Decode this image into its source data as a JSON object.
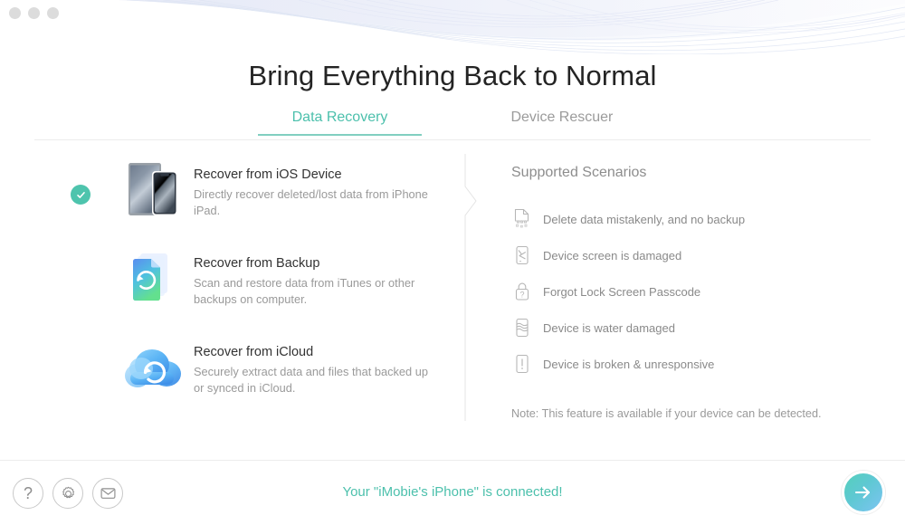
{
  "window": {
    "dots": [
      "close-dot",
      "minimize-dot",
      "maximize-dot"
    ]
  },
  "header": {
    "title": "Bring Everything Back to Normal"
  },
  "tabs": [
    {
      "label": "Data Recovery",
      "active": true
    },
    {
      "label": "Device Rescuer",
      "active": false
    }
  ],
  "options": [
    {
      "title": "Recover from iOS Device",
      "desc": "Directly recover deleted/lost data from iPhone iPad.",
      "icon": "ipad-iphone-devices-icon",
      "selected": true
    },
    {
      "title": "Recover from Backup",
      "desc": "Scan and restore data from iTunes or other backups on computer.",
      "icon": "backup-folder-refresh-icon",
      "selected": false
    },
    {
      "title": "Recover from iCloud",
      "desc": "Securely extract data and files that backed up or synced in iCloud.",
      "icon": "icloud-refresh-icon",
      "selected": false
    }
  ],
  "scenarios": {
    "heading": "Supported Scenarios",
    "items": [
      {
        "label": "Delete data mistakenly, and no backup",
        "icon": "document-dissolving-icon"
      },
      {
        "label": "Device screen is damaged",
        "icon": "cracked-screen-icon"
      },
      {
        "label": "Forgot Lock Screen Passcode",
        "icon": "lock-question-icon"
      },
      {
        "label": "Device is water damaged",
        "icon": "water-damage-icon"
      },
      {
        "label": "Device is broken & unresponsive",
        "icon": "device-alert-icon"
      }
    ],
    "note": "Note: This feature is available if your device can be detected."
  },
  "footer": {
    "help_label": "?",
    "buttons": [
      {
        "name": "help-button",
        "icon": "question-mark-icon"
      },
      {
        "name": "settings-button",
        "icon": "gear-icon"
      },
      {
        "name": "feedback-button",
        "icon": "mail-icon"
      }
    ],
    "status": "Your \"iMobie's iPhone\" is connected!",
    "next_icon": "arrow-right-icon"
  },
  "colors": {
    "accent_teal": "#4cc0ac",
    "check_badge": "#4ec4ad",
    "text_dark": "#333333",
    "text_muted": "#9a9a9a",
    "next_gradient_start": "#54d0bb",
    "next_gradient_end": "#7cc4f2"
  }
}
